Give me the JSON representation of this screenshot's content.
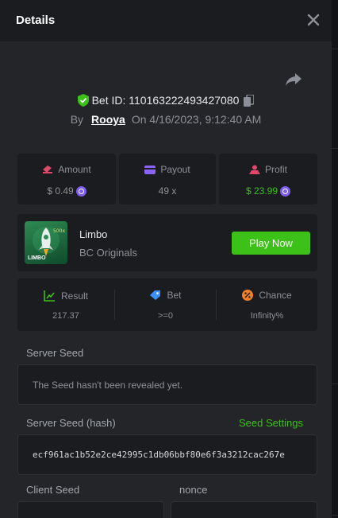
{
  "modal": {
    "title": "Details"
  },
  "bet": {
    "id_label": "Bet ID: 110163222493427080",
    "by": "By",
    "user": "Rooya",
    "on": "On",
    "datetime": "4/16/2023, 9:12:40 AM"
  },
  "stats": {
    "amount": {
      "label": "Amount",
      "value": "$ 0.49"
    },
    "payout": {
      "label": "Payout",
      "value": "49 x"
    },
    "profit": {
      "label": "Profit",
      "value": "$ 23.99"
    }
  },
  "game": {
    "name": "Limbo",
    "provider": "BC Originals",
    "thumb_label": "LIMBO",
    "play_label": "Play Now"
  },
  "result": {
    "result": {
      "label": "Result",
      "value": "217.37"
    },
    "bet": {
      "label": "Bet",
      "value": ">=0"
    },
    "chance": {
      "label": "Chance",
      "value": "Infinity%"
    }
  },
  "seeds": {
    "server_seed_label": "Server Seed",
    "server_seed_value": "The Seed hasn't been revealed yet.",
    "server_hash_label": "Server Seed (hash)",
    "seed_settings_label": "Seed Settings",
    "server_hash_value": "ecf961ac1b52e2ce42995c1db06bbf80e6f3a3212cac267e",
    "client_seed_label": "Client Seed",
    "nonce_label": "nonce"
  },
  "colors": {
    "accent_green": "#3bc117",
    "coin_purple": "#7d5cf2",
    "panel": "#1b1c1f",
    "modal_bg": "#232528"
  },
  "icons": [
    "close-icon",
    "share-icon",
    "shield-check-icon",
    "copy-icon",
    "amount-icon",
    "payout-card-icon",
    "profit-icon",
    "coin-icon",
    "result-chart-icon",
    "bet-tag-icon",
    "chance-percent-icon"
  ]
}
